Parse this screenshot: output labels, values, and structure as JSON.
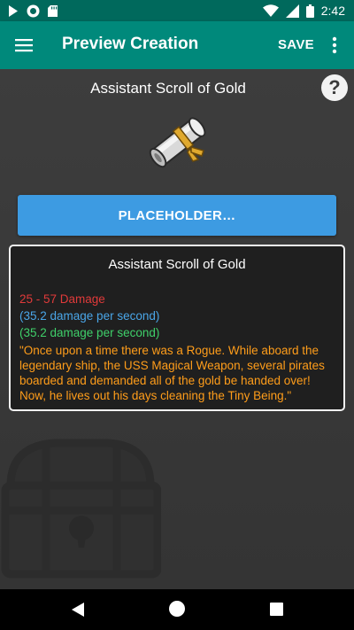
{
  "status_bar": {
    "time": "2:42",
    "left_icons": [
      "play-store-icon",
      "circle-app-icon",
      "sd-card-icon"
    ],
    "right_icons": [
      "wifi-icon",
      "signal-icon",
      "battery-icon"
    ]
  },
  "app_bar": {
    "title": "Preview Creation",
    "save_label": "SAVE",
    "menu_icon": "hamburger-menu-icon",
    "more_icon": "more-vert-icon"
  },
  "main": {
    "item_title": "Assistant Scroll of Gold",
    "help_label": "?",
    "action_button_label": "PLACEHOLDER…",
    "card": {
      "title": "Assistant Scroll of Gold",
      "damage": "25 - 57 Damage",
      "dps_line_1": "(35.2 damage per second)",
      "dps_line_2": "(35.2 damage per second)",
      "story": "\"Once upon a time there was a Rogue. While aboard the legendary ship, the USS Magical Weapon, several pirates boarded and demanded all of the gold be handed over! Now, he lives out his days cleaning the Tiny Being.\""
    }
  },
  "colors": {
    "status_bar": "#00695c",
    "app_bar": "#00897b",
    "button": "#3d9be2",
    "damage": "#e03a3a",
    "dps_blue": "#4aa6e8",
    "dps_green": "#3fd06a",
    "story": "#ff9d1a"
  }
}
